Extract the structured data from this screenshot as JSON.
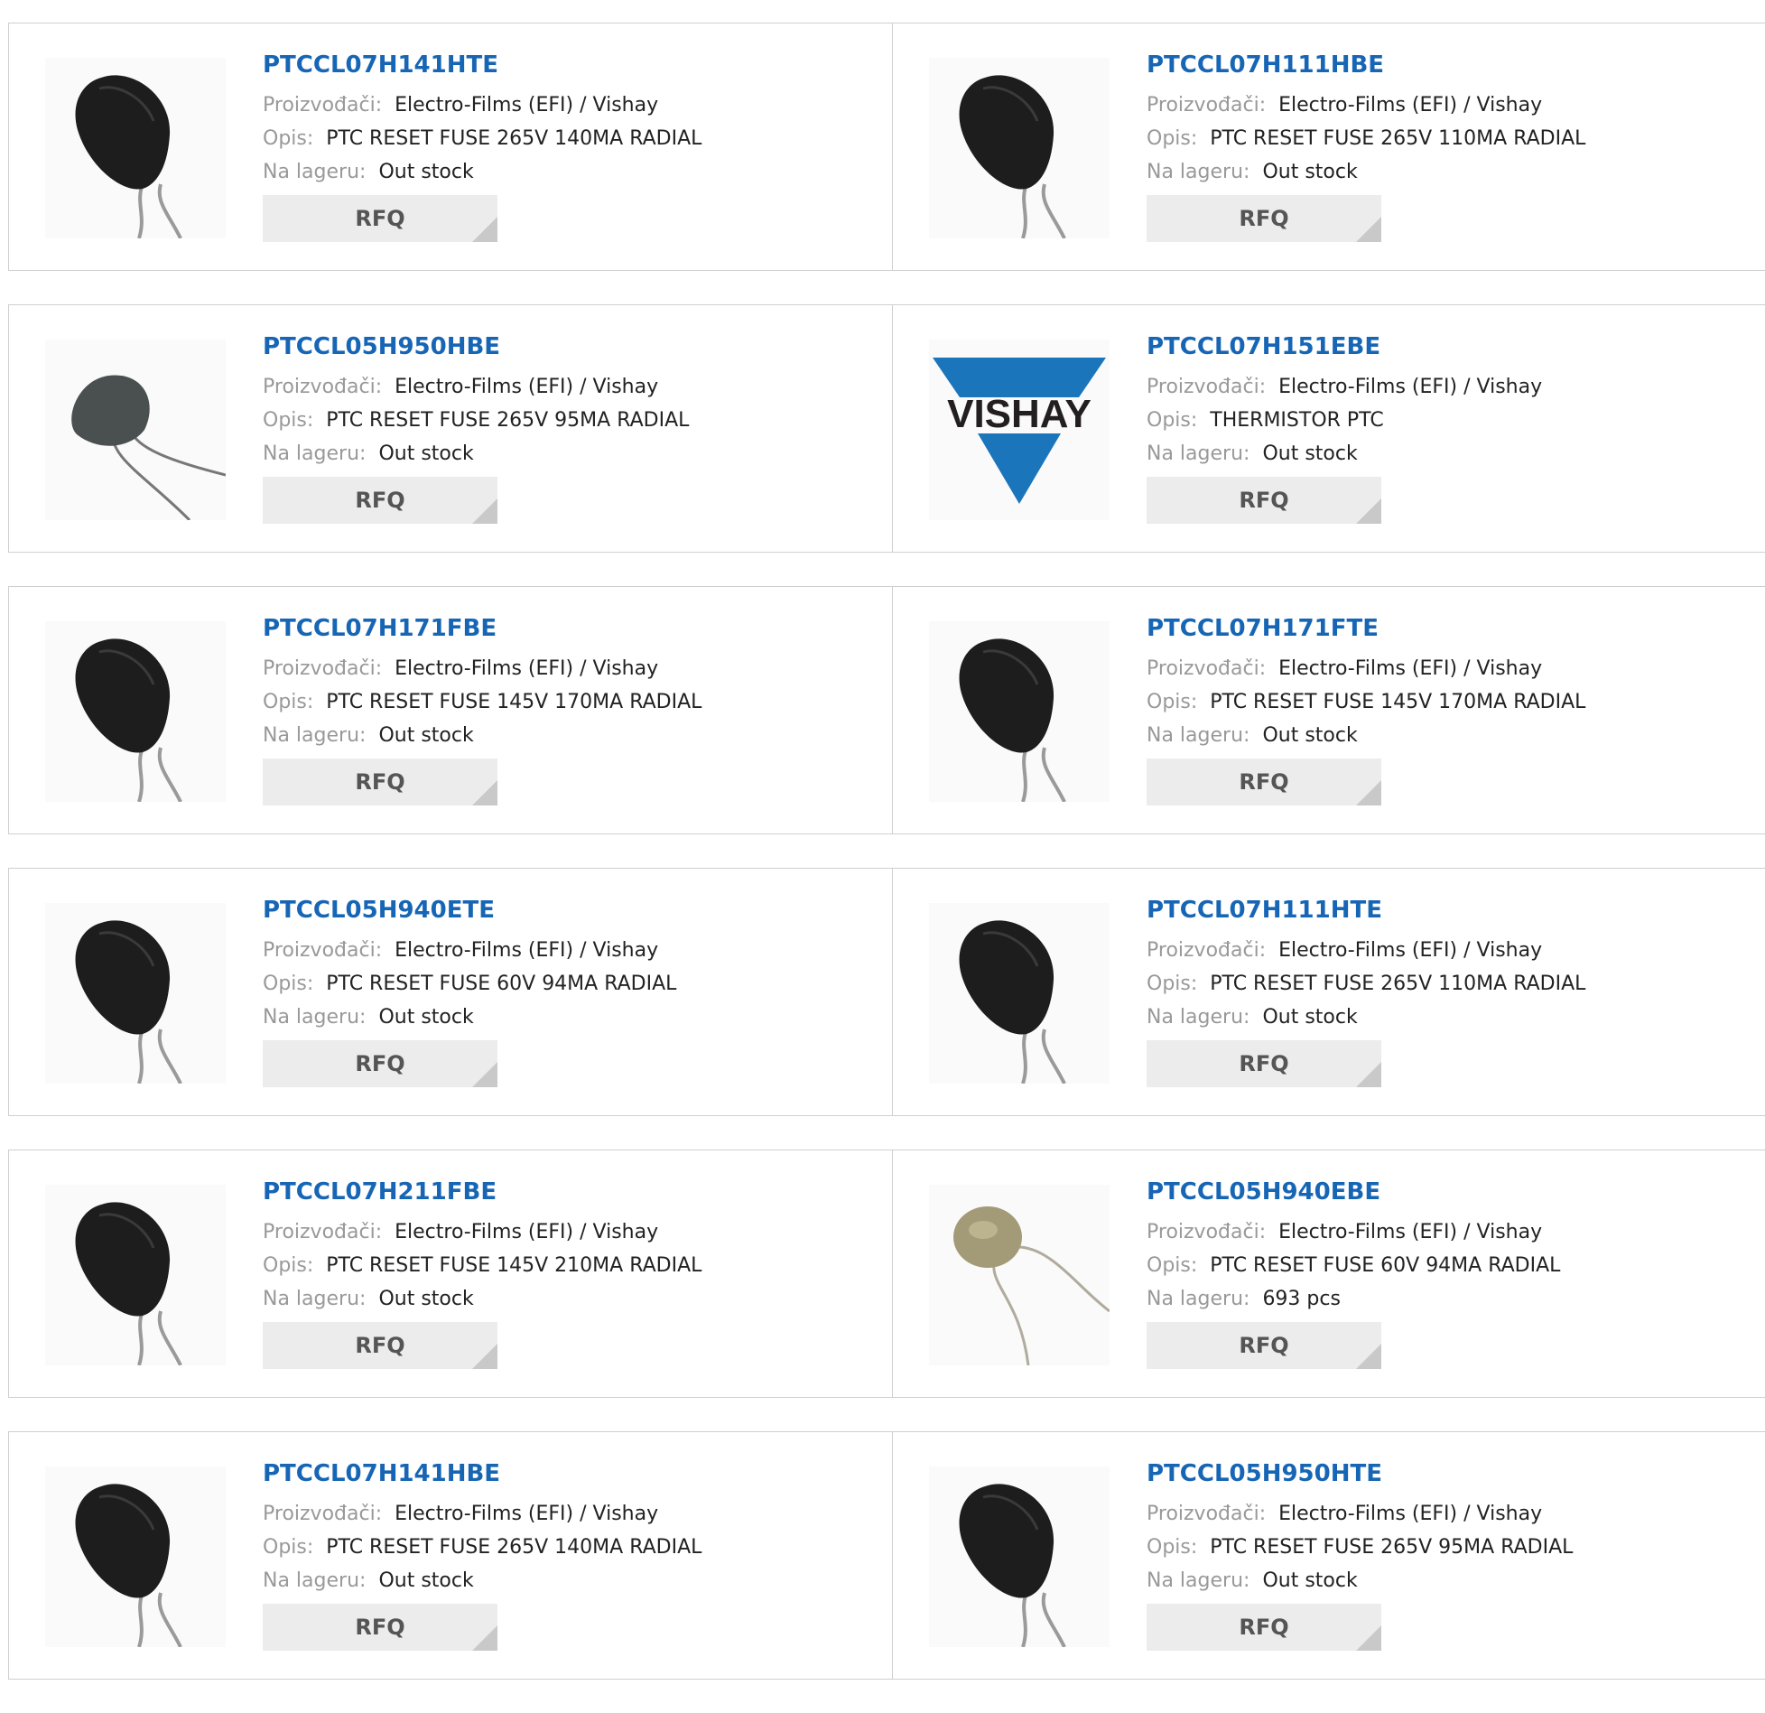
{
  "labels": {
    "manufacturer": "Proizvođači:",
    "description": "Opis:",
    "stock": "Na lageru:",
    "rfq": "RFQ"
  },
  "colors": {
    "link": "#1766b5",
    "label": "#999999",
    "button_bg": "#ececec",
    "vishay_blue": "#1b75bb"
  },
  "products": [
    {
      "part": "PTCCL07H141HTE",
      "manufacturer": "Electro-Films (EFI) / Vishay",
      "description": "PTC RESET FUSE 265V 140MA RADIAL",
      "stock": "Out stock",
      "image": "thermistor-black"
    },
    {
      "part": "PTCCL07H111HBE",
      "manufacturer": "Electro-Films (EFI) / Vishay",
      "description": "PTC RESET FUSE 265V 110MA RADIAL",
      "stock": "Out stock",
      "image": "thermistor-black"
    },
    {
      "part": "PTCCL05H950HBE",
      "manufacturer": "Electro-Films (EFI) / Vishay",
      "description": "PTC RESET FUSE 265V 95MA RADIAL",
      "stock": "Out stock",
      "image": "thermistor-gray"
    },
    {
      "part": "PTCCL07H151EBE",
      "manufacturer": "Electro-Films (EFI) / Vishay",
      "description": "THERMISTOR PTC",
      "stock": "Out stock",
      "image": "vishay-logo",
      "logo_text": "VISHAY"
    },
    {
      "part": "PTCCL07H171FBE",
      "manufacturer": "Electro-Films (EFI) / Vishay",
      "description": "PTC RESET FUSE 145V 170MA RADIAL",
      "stock": "Out stock",
      "image": "thermistor-black"
    },
    {
      "part": "PTCCL07H171FTE",
      "manufacturer": "Electro-Films (EFI) / Vishay",
      "description": "PTC RESET FUSE 145V 170MA RADIAL",
      "stock": "Out stock",
      "image": "thermistor-black"
    },
    {
      "part": "PTCCL05H940ETE",
      "manufacturer": "Electro-Films (EFI) / Vishay",
      "description": "PTC RESET FUSE 60V 94MA RADIAL",
      "stock": "Out stock",
      "image": "thermistor-black"
    },
    {
      "part": "PTCCL07H111HTE",
      "manufacturer": "Electro-Films (EFI) / Vishay",
      "description": "PTC RESET FUSE 265V 110MA RADIAL",
      "stock": "Out stock",
      "image": "thermistor-black"
    },
    {
      "part": "PTCCL07H211FBE",
      "manufacturer": "Electro-Films (EFI) / Vishay",
      "description": "PTC RESET FUSE 145V 210MA RADIAL",
      "stock": "Out stock",
      "image": "thermistor-black"
    },
    {
      "part": "PTCCL05H940EBE",
      "manufacturer": "Electro-Films (EFI) / Vishay",
      "description": "PTC RESET FUSE 60V 94MA RADIAL",
      "stock": "693 pcs",
      "image": "thermistor-tan"
    },
    {
      "part": "PTCCL07H141HBE",
      "manufacturer": "Electro-Films (EFI) / Vishay",
      "description": "PTC RESET FUSE 265V 140MA RADIAL",
      "stock": "Out stock",
      "image": "thermistor-black"
    },
    {
      "part": "PTCCL05H950HTE",
      "manufacturer": "Electro-Films (EFI) / Vishay",
      "description": "PTC RESET FUSE 265V 95MA RADIAL",
      "stock": "Out stock",
      "image": "thermistor-black"
    }
  ]
}
